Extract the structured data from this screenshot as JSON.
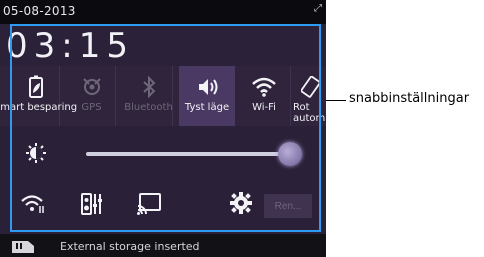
{
  "statusbar": {
    "date": "05-08-2013",
    "corner_icon": "expand-arrow-icon"
  },
  "clock": {
    "time": "03:15"
  },
  "quick_settings": {
    "tiles": [
      {
        "id": "smart-saving",
        "label": "Smart besparing",
        "icon": "battery-leaf-icon",
        "state": "on"
      },
      {
        "id": "gps",
        "label": "GPS",
        "icon": "gps-icon",
        "state": "off"
      },
      {
        "id": "bluetooth",
        "label": "Bluetooth",
        "icon": "bluetooth-icon",
        "state": "off"
      },
      {
        "id": "silent",
        "label": "Tyst läge",
        "icon": "vibrate-speaker-icon",
        "state": "active"
      },
      {
        "id": "wifi",
        "label": "Wi-Fi",
        "icon": "wifi-icon",
        "state": "on"
      },
      {
        "id": "rotate",
        "label": "Rot autom",
        "icon": "rotate-icon",
        "state": "on"
      }
    ]
  },
  "brightness": {
    "icon": "brightness-icon",
    "level": 1.0
  },
  "bottom_row": {
    "icons": [
      "wifi-settings-icon",
      "equalizer-icon",
      "cast-screen-icon",
      "settings-gear-icon"
    ],
    "clear_button": "Ren..."
  },
  "notification": {
    "icon": "storage-card-icon",
    "text": "External storage inserted"
  },
  "callout": {
    "label": "snabbinställningar"
  },
  "colors": {
    "frame": "#2e9af0",
    "panel": "#2b2138",
    "active_tile": "#4a3a63"
  }
}
